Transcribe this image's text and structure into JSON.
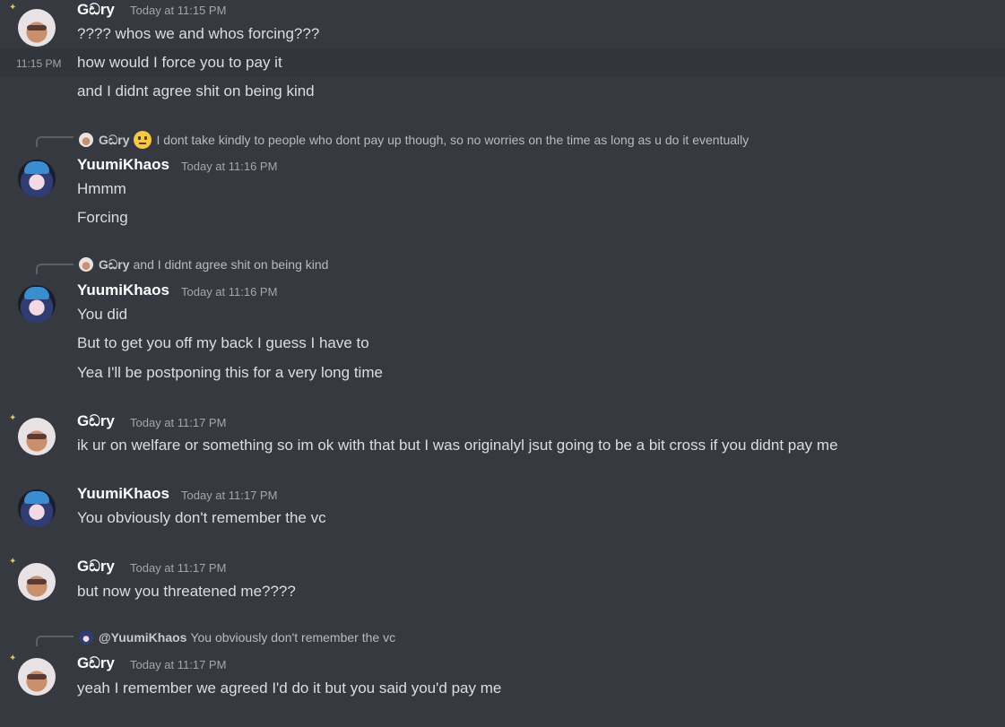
{
  "messages": [
    {
      "author": "Gඩry",
      "time": "Today at 11:15 PM",
      "lines": [
        "???? whos we and whos forcing???"
      ]
    },
    {
      "hover_time": "11:15 PM",
      "lines": [
        "how would I force you to pay it",
        "and I didnt agree shit on being kind"
      ]
    },
    {
      "reply": {
        "author": "Gඩry",
        "emoji": "neutral-face",
        "text": "I dont take kindly to people who dont pay up though, so no worries on the time as long as u do it eventually"
      },
      "author": "YuumiKhaos",
      "time": "Today at 11:16 PM",
      "lines": [
        "Hmmm",
        "Forcing"
      ]
    },
    {
      "reply": {
        "author": "Gඩry",
        "text": "and I didnt agree shit on being kind"
      },
      "author": "YuumiKhaos",
      "time": "Today at 11:16 PM",
      "lines": [
        "You did",
        "But to get you off my back I guess I have to",
        "Yea I'll be postponing this for a very long time"
      ]
    },
    {
      "author": "Gඩry",
      "time": "Today at 11:17 PM",
      "lines": [
        "ik ur on welfare or something so im ok with that but I was originalyl jsut going to be a bit cross if you didnt pay me"
      ]
    },
    {
      "author": "YuumiKhaos",
      "time": "Today at 11:17 PM",
      "lines": [
        "You obviously don't remember the vc"
      ]
    },
    {
      "author": "Gඩry",
      "time": "Today at 11:17 PM",
      "lines": [
        "but now you threatened me????"
      ]
    },
    {
      "reply": {
        "author": "@YuumiKhaos",
        "text": "You obviously don't remember the vc"
      },
      "author": "Gඩry",
      "time": "Today at 11:17 PM",
      "lines": [
        "yeah I remember we agreed I'd do it but you said you'd pay me"
      ]
    }
  ]
}
